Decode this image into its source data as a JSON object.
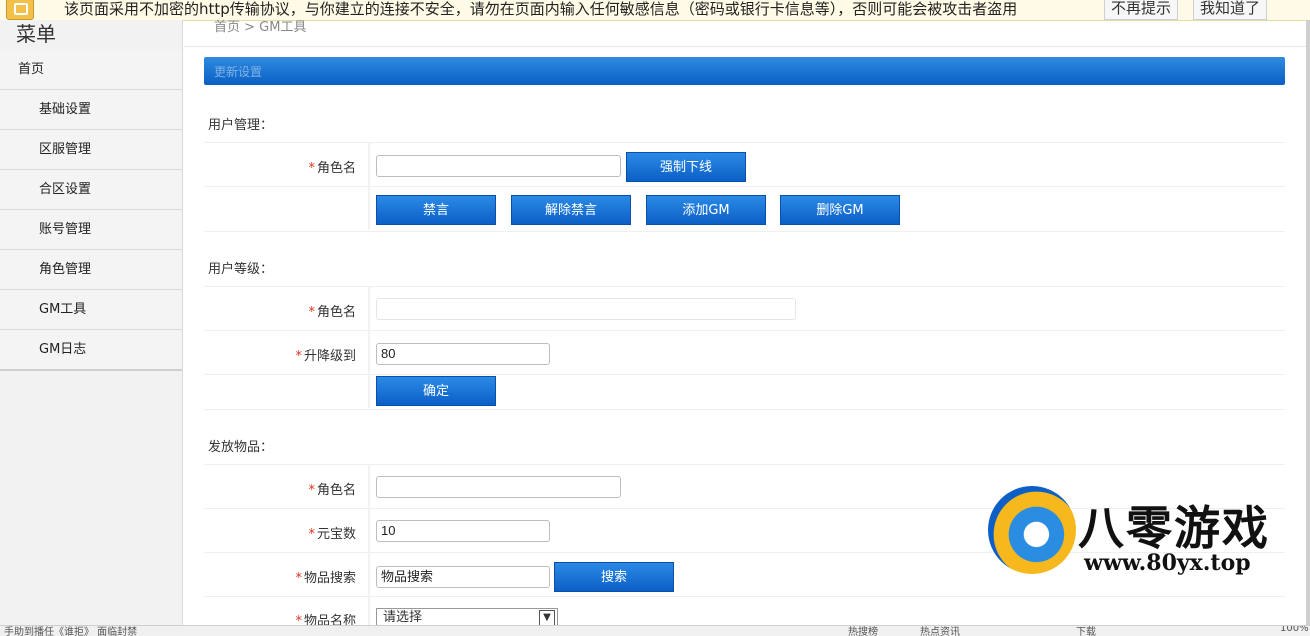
{
  "warning": {
    "message": "该页面采用不加密的http传输协议，与你建立的连接不安全，请勿在页面内输入任何敏感信息（密码或银行卡信息等），否则可能会被攻击者盗用",
    "dismiss_label": "不再提示",
    "ack_label": "我知道了"
  },
  "sidebar": {
    "title": "菜单",
    "items": [
      {
        "label": "首页"
      },
      {
        "label": "基础设置"
      },
      {
        "label": "区服管理"
      },
      {
        "label": "合区设置"
      },
      {
        "label": "账号管理"
      },
      {
        "label": "角色管理"
      },
      {
        "label": "GM工具"
      },
      {
        "label": "GM日志"
      }
    ]
  },
  "breadcrumb": "首页 > GM工具",
  "panel_title": "更新设置",
  "user_mgmt": {
    "title": "用户管理：",
    "role_label": "角色名",
    "role_value": "",
    "kick_label": "强制下线",
    "mute_label": "禁言",
    "unmute_label": "解除禁言",
    "add_gm_label": "添加GM",
    "remove_gm_label": "删除GM"
  },
  "user_level": {
    "title": "用户等级：",
    "role_label": "角色名",
    "role_value": "",
    "level_label": "升降级到",
    "level_value": "80",
    "confirm_label": "确定"
  },
  "give_items": {
    "title": "发放物品：",
    "role_label": "角色名",
    "role_value": "",
    "yuanbao_label": "元宝数",
    "yuanbao_value": "10",
    "search_label": "物品搜索",
    "search_value": "物品搜索",
    "search_button": "搜索",
    "item_name_label": "物品名称",
    "item_select": "请选择"
  },
  "watermark": {
    "brand": "八零游戏",
    "url": "www.80yx.top"
  },
  "status_bar": {
    "left_text": "手助到播任《谁拒》 面临封禁",
    "items": [
      "热搜榜",
      "热点资讯",
      "下载",
      "100%"
    ]
  },
  "colors": {
    "primary_blue": "#0c5fc7",
    "required": "#e0301e",
    "warning_bg": "#fffbe6"
  }
}
